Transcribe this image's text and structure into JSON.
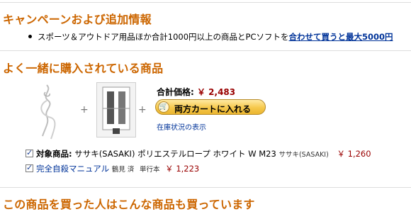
{
  "campaign": {
    "title": "キャンペーンおよび追加情報",
    "bullet_text": "スポーツ＆アウトドア用品ほか合計1000円以上の商品とPCソフトを",
    "bullet_link": "合わせて買うと最大5000円"
  },
  "bought_together": {
    "title": "よく一緒に購入されている商品",
    "plus": "+",
    "total_label": "合計価格:",
    "total_price": "￥ 2,483",
    "cart_button_label": "両方カートに入れる",
    "stock_link": "在庫状況の表示",
    "items": [
      {
        "prefix": "対象商品:",
        "name": "ササキ(SASAKI) ポリエステルロープ ホワイト W M23",
        "maker": "ササキ(SASAKI)",
        "price": "￥ 1,260"
      },
      {
        "name": "完全自殺マニュアル",
        "author": "鶴見 済",
        "format": "単行本",
        "price": "￥ 1,223"
      }
    ]
  },
  "also_bought": {
    "title": "この商品を買った人はこんな商品も買っています"
  },
  "colors": {
    "heading": "#cc6600",
    "price": "#990000",
    "link": "#003399",
    "button": "#f6c84b"
  },
  "icons": [
    "cart-icon",
    "checkbox-checked-icon",
    "bullet-icon"
  ]
}
